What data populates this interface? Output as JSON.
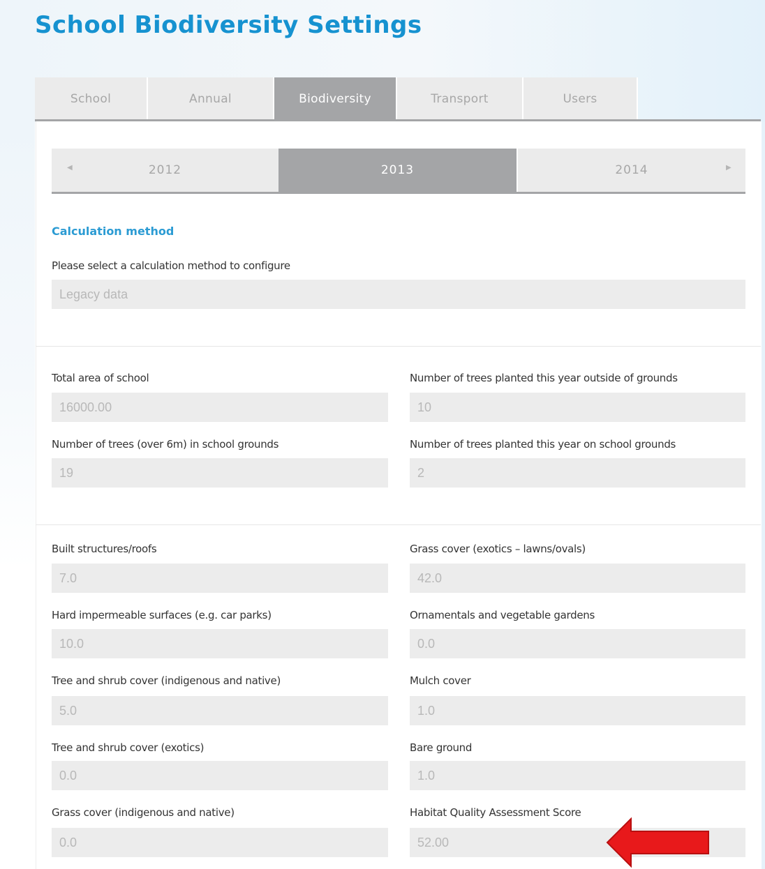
{
  "page_title": "School Biodiversity Settings",
  "tabs": [
    {
      "label": "School",
      "active": false
    },
    {
      "label": "Annual",
      "active": false
    },
    {
      "label": "Biodiversity",
      "active": true
    },
    {
      "label": "Transport",
      "active": false
    },
    {
      "label": "Users",
      "active": false
    }
  ],
  "years": {
    "prev": "2012",
    "current": "2013",
    "next": "2014",
    "prev_arrow_icon": "chevron-left-icon",
    "next_arrow_icon": "chevron-right-icon"
  },
  "calculation": {
    "section_title": "Calculation method",
    "select_label": "Please select a calculation method to configure",
    "select_value": "Legacy data"
  },
  "trees": {
    "total_area_label": "Total area of school",
    "total_area_value": "16000.00",
    "trees_outside_label": "Number of trees planted this year outside of grounds",
    "trees_outside_value": "10",
    "trees_over6m_label": "Number of trees (over 6m) in school grounds",
    "trees_over6m_value": "19",
    "trees_on_grounds_label": "Number of trees planted this year on school grounds",
    "trees_on_grounds_value": "2"
  },
  "cover": {
    "built_label": "Built structures/roofs",
    "built_value": "7.0",
    "grass_exotic_label": "Grass cover (exotics – lawns/ovals)",
    "grass_exotic_value": "42.0",
    "hard_label": "Hard impermeable surfaces (e.g. car parks)",
    "hard_value": "10.0",
    "ornamental_label": "Ornamentals and vegetable gardens",
    "ornamental_value": "0.0",
    "tree_native_label": "Tree and shrub cover (indigenous and native)",
    "tree_native_value": "5.0",
    "mulch_label": "Mulch cover",
    "mulch_value": "1.0",
    "tree_exotic_label": "Tree and shrub cover (exotics)",
    "tree_exotic_value": "0.0",
    "bare_label": "Bare ground",
    "bare_value": "1.0",
    "grass_native_label": "Grass cover (indigenous and native)",
    "grass_native_value": "0.0",
    "habitat_label": "Habitat Quality Assessment Score",
    "habitat_value": "52.00"
  },
  "annotation": {
    "icon": "red-arrow-icon",
    "color": "#e8191b"
  },
  "colors": {
    "accent": "#1692d0",
    "tab_active": "#a4a5a7",
    "field_bg": "#ececec"
  }
}
